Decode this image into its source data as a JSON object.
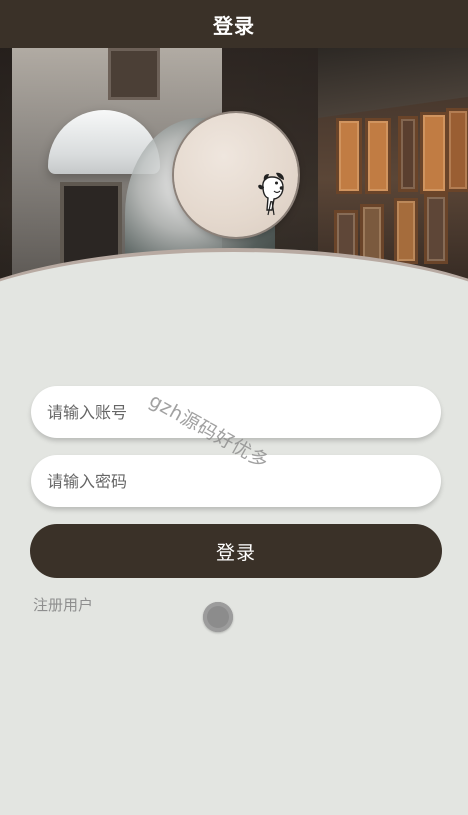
{
  "header": {
    "title": "登录"
  },
  "hero": {
    "avatar_label": "snoopy avatar"
  },
  "form": {
    "account_placeholder": "请输入账号",
    "password_placeholder": "请输入密码",
    "submit_label": "登录",
    "register_label": "注册用户"
  },
  "watermark": {
    "text": "gzh源码好优多"
  },
  "colors": {
    "header_bg": "#3a3128",
    "page_bg": "#e3e5e1",
    "button_bg": "#3a3128",
    "input_bg": "#ffffff",
    "muted_text": "#8e8e8e"
  }
}
